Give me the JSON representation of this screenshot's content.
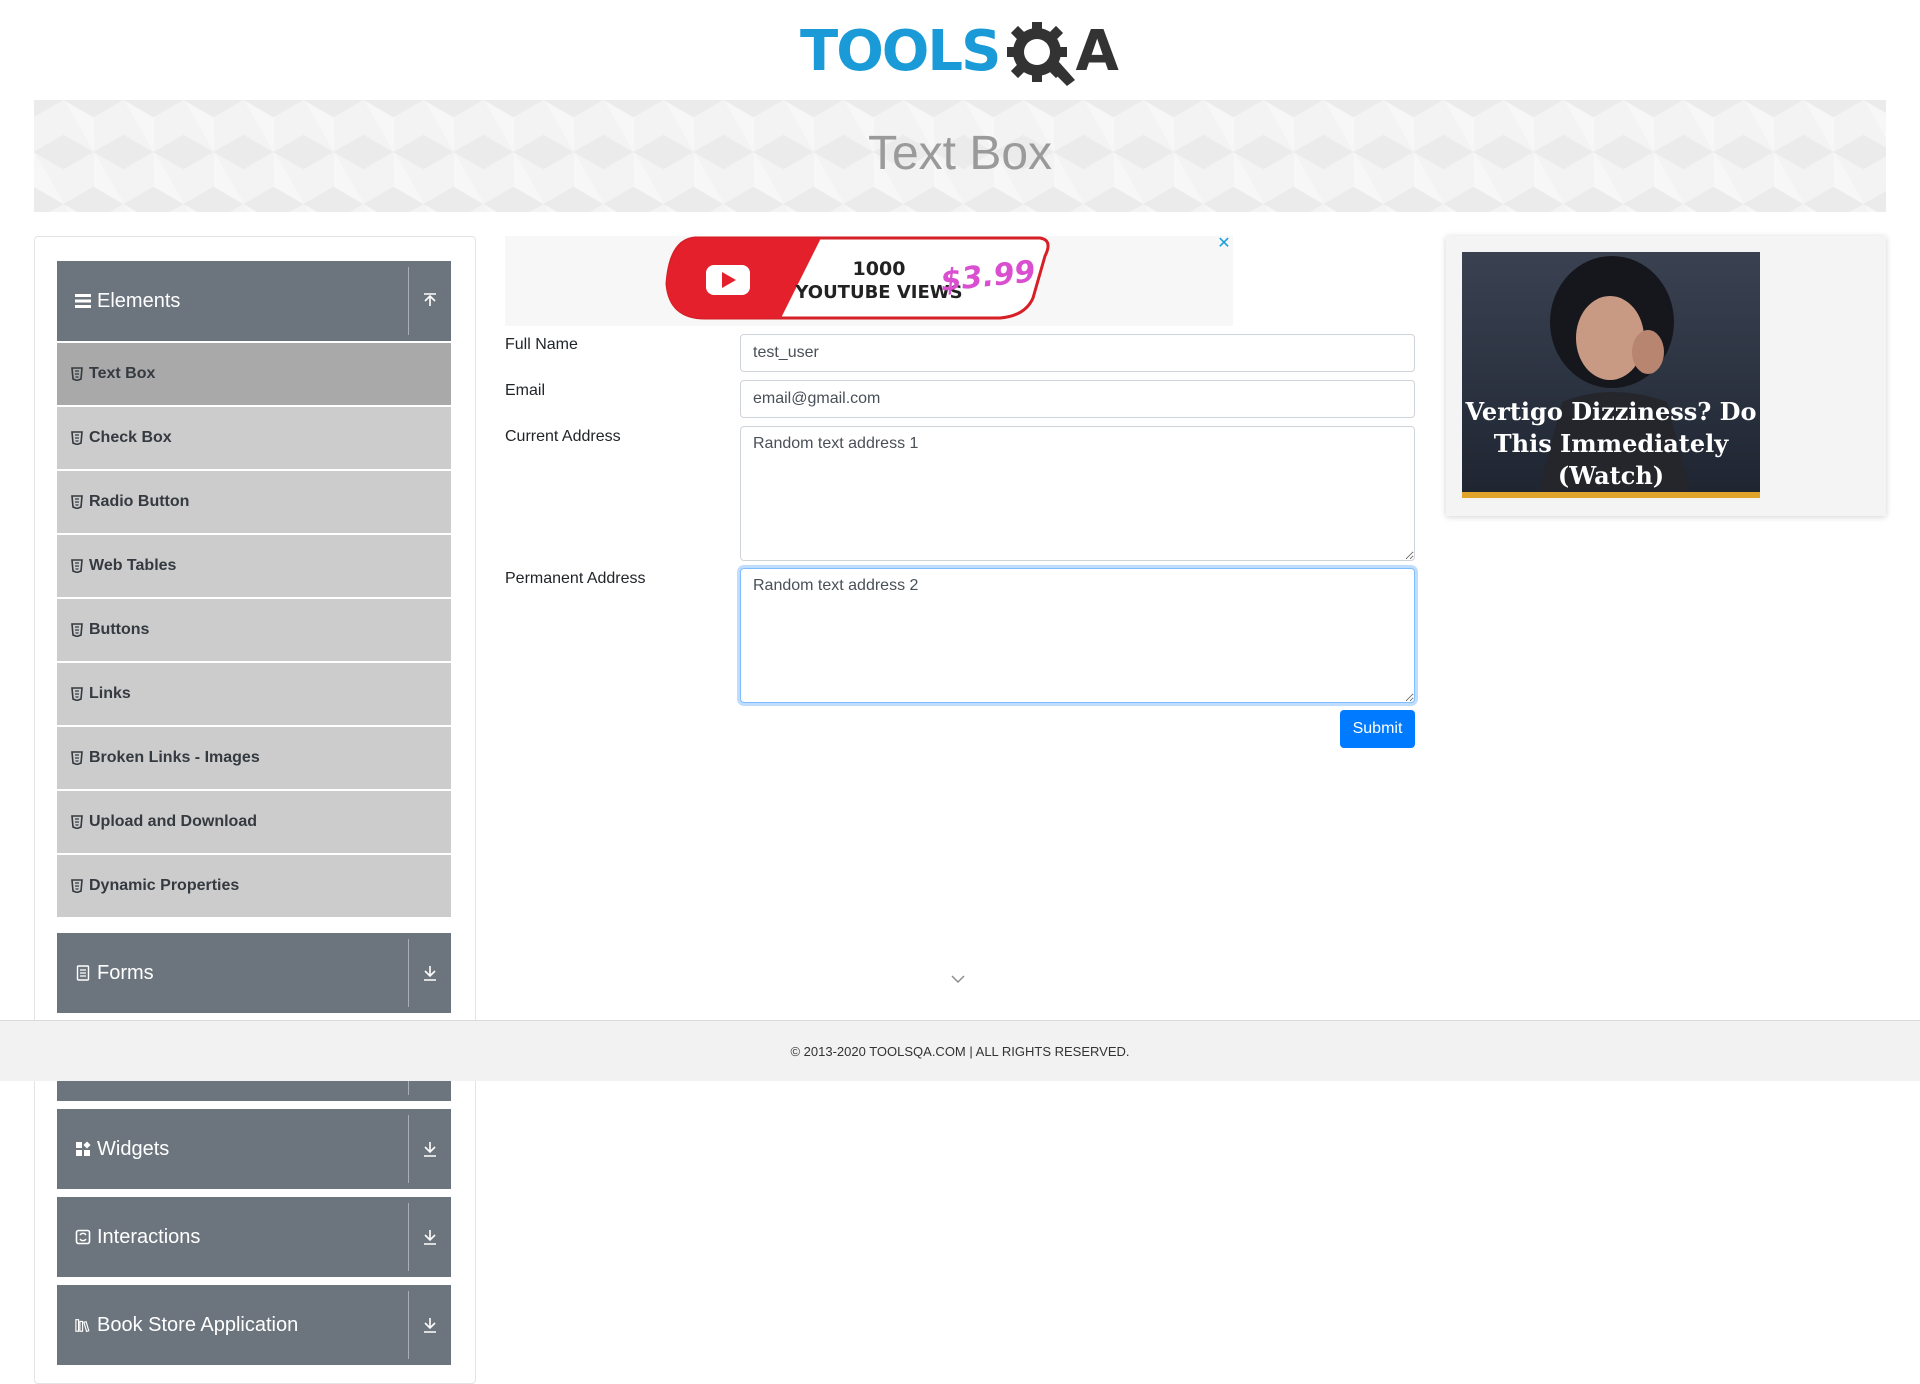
{
  "logo": {
    "text_main": "TOOLS",
    "text_q": "Q",
    "text_a": "A"
  },
  "banner": {
    "title": "Text Box"
  },
  "sidebar": {
    "groups": [
      {
        "title": "Elements",
        "icon": "hamburger-icon",
        "expanded": true
      },
      {
        "title": "Forms",
        "icon": "document-icon",
        "expanded": false
      },
      {
        "title": "Widgets",
        "icon": "widgets-icon",
        "expanded": false
      },
      {
        "title": "Interactions",
        "icon": "interactions-icon",
        "expanded": false
      },
      {
        "title": "Book Store Application",
        "icon": "books-icon",
        "expanded": false
      }
    ],
    "items": [
      {
        "label": "Text Box",
        "active": true
      },
      {
        "label": "Check Box"
      },
      {
        "label": "Radio Button"
      },
      {
        "label": "Web Tables"
      },
      {
        "label": "Buttons"
      },
      {
        "label": "Links"
      },
      {
        "label": "Broken Links - Images"
      },
      {
        "label": "Upload and Download"
      },
      {
        "label": "Dynamic Properties"
      }
    ]
  },
  "ad_top": {
    "line1": "1000",
    "line2": "YOUTUBE VIEWS",
    "price": "$3.99",
    "close": "✕"
  },
  "form": {
    "full_name_label": "Full Name",
    "full_name_value": "test_user",
    "email_label": "Email",
    "email_value": "email@gmail.com",
    "current_address_label": "Current Address",
    "current_address_value": "Random text address 1",
    "permanent_address_label": "Permanent Address",
    "permanent_address_value": "Random text address 2",
    "submit_label": "Submit"
  },
  "ad_right": {
    "headline": "Vertigo Dizziness? Do This Immediately (Watch)"
  },
  "footer": {
    "text": "© 2013-2020 TOOLSQA.COM | ALL RIGHTS RESERVED."
  },
  "colors": {
    "accent": "#007bff",
    "sidebar_header": "#6c757d",
    "menu_item": "#cccccc",
    "menu_active": "#a9a9a9",
    "logo_blue": "#1a9bd7"
  }
}
